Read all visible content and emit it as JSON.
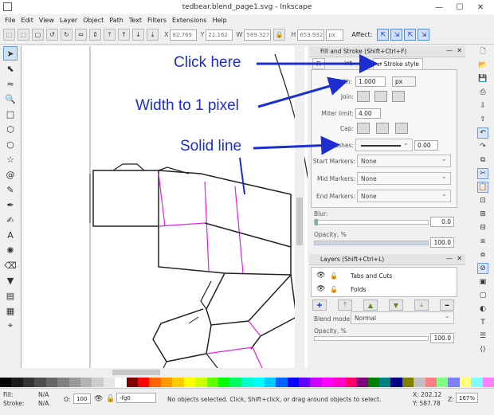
{
  "window": {
    "title": "tedbear.blend_page1.svg - Inkscape",
    "minimize_glyph": "—",
    "maximize_glyph": "☐",
    "close_glyph": "✕"
  },
  "menu": [
    "File",
    "Edit",
    "View",
    "Layer",
    "Object",
    "Path",
    "Text",
    "Filters",
    "Extensions",
    "Help"
  ],
  "toolbar": {
    "x_label": "X",
    "x_value": "82.769",
    "y_label": "Y",
    "y_value": "21.162",
    "w_label": "W",
    "w_value": "589.327",
    "h_label": "H",
    "h_value": "653.932",
    "unit": "px",
    "affect_label": "Affect:"
  },
  "fill_stroke": {
    "title": "Fill and Stroke (Shift+Ctrl+F)",
    "tab_fill_partial": "Fi",
    "tab_stroke_paint_partial": "int",
    "tab_stroke_style": "Stroke style",
    "width_label": "Width:",
    "width_value": "1.000",
    "width_unit": "px",
    "join_label": "Join:",
    "miter_label": "Miter limit:",
    "miter_value": "4.00",
    "cap_label": "Cap:",
    "dashes_label": "Dashes:",
    "dashes_offset": "0.00",
    "start_markers_label": "Start Markers:",
    "mid_markers_label": "Mid Markers:",
    "end_markers_label": "End Markers:",
    "markers_value": "None",
    "blur_label": "Blur:",
    "blur_value": "0.0",
    "opacity_label": "Opacity, %",
    "opacity_value": "100.0",
    "opacity_level": 1.0
  },
  "layers": {
    "title": "Layers (Shift+Ctrl+L)",
    "items": [
      "Tabs and Cuts",
      "Folds"
    ],
    "blend_label": "Blend mode:",
    "blend_value": "Normal",
    "opacity_label": "Opacity, %",
    "opacity_value": "100.0"
  },
  "annotations": {
    "click_here": "Click here",
    "width_to_1": "Width to 1 pixel",
    "solid_line": "Solid line"
  },
  "status": {
    "fill_label": "Fill:",
    "fill_value": "N/A",
    "stroke_label": "Stroke:",
    "stroke_value": "N/A",
    "o_label": "O:",
    "o_value": "100",
    "layer_value": "-fg0",
    "message": "No objects selected. Click, Shift+click, or drag around objects to select.",
    "x_coord": "X: 202.12",
    "y_coord": "Y: 587.78",
    "z_label": "Z:",
    "zoom": "167%"
  },
  "colors": {
    "annotation": "#1d2ed0",
    "fold_line": "#e020e0",
    "palette": [
      "#000000",
      "#1a1a1a",
      "#333333",
      "#4d4d4d",
      "#666666",
      "#808080",
      "#999999",
      "#b3b3b3",
      "#cccccc",
      "#e6e6e6",
      "#ffffff",
      "#800000",
      "#ff0000",
      "#ff6600",
      "#ff9900",
      "#ffcc00",
      "#ffff00",
      "#ccff00",
      "#66ff00",
      "#00ff00",
      "#00ff66",
      "#00ffcc",
      "#00ffff",
      "#00ccff",
      "#0066ff",
      "#0000ff",
      "#6600ff",
      "#cc00ff",
      "#ff00ff",
      "#ff00cc",
      "#ff0066",
      "#800080",
      "#008000",
      "#008080",
      "#000080",
      "#808000",
      "#c0c0c0",
      "#ff8080",
      "#80ff80",
      "#8080ff",
      "#ffff80",
      "#80ffff",
      "#ff80ff"
    ]
  },
  "icons": {
    "tools": [
      "select-arrow-icon",
      "node-edit-icon",
      "tweak-icon",
      "zoom-icon",
      "rectangle-icon",
      "box3d-icon",
      "ellipse-icon",
      "star-icon",
      "spiral-icon",
      "pencil-icon",
      "pen-icon",
      "calligraphy-icon",
      "text-icon",
      "spray-icon",
      "eraser-icon",
      "bucket-icon",
      "gradient-icon",
      "mesh-icon",
      "dropper-icon",
      "connector-icon"
    ],
    "tool_glyphs": [
      "➤",
      "⬉",
      "≈",
      "🔍",
      "□",
      "⬡",
      "○",
      "☆",
      "@",
      "✎",
      "✒",
      "✍",
      "A",
      "✺",
      "⌫",
      "▼",
      "▤",
      "▦",
      "⌖",
      "⤳"
    ],
    "commands": [
      "new-doc-icon",
      "open-icon",
      "save-icon",
      "print-icon",
      "import-icon",
      "export-icon",
      "undo-icon",
      "redo-icon",
      "copy-icon",
      "cut-icon",
      "paste-icon",
      "zoom-sel-icon",
      "zoom-draw-icon",
      "zoom-page-icon",
      "duplicate-icon",
      "clone-icon",
      "unlink-icon",
      "group-icon",
      "ungroup-icon",
      "fill-stroke-icon",
      "text-font-icon",
      "layers-icon",
      "xml-icon",
      "align-icon",
      "snap-icon"
    ],
    "command_glyphs": [
      "🗋",
      "📂",
      "💾",
      "⎙",
      "⇩",
      "⇧",
      "↶",
      "↷",
      "⧉",
      "✂",
      "📋",
      "⊡",
      "⊞",
      "⊟",
      "⧈",
      "⧇",
      "⊘",
      "▣",
      "▢",
      "◐",
      "T",
      "☰",
      "⟨⟩",
      "⫼",
      "⌗"
    ]
  }
}
